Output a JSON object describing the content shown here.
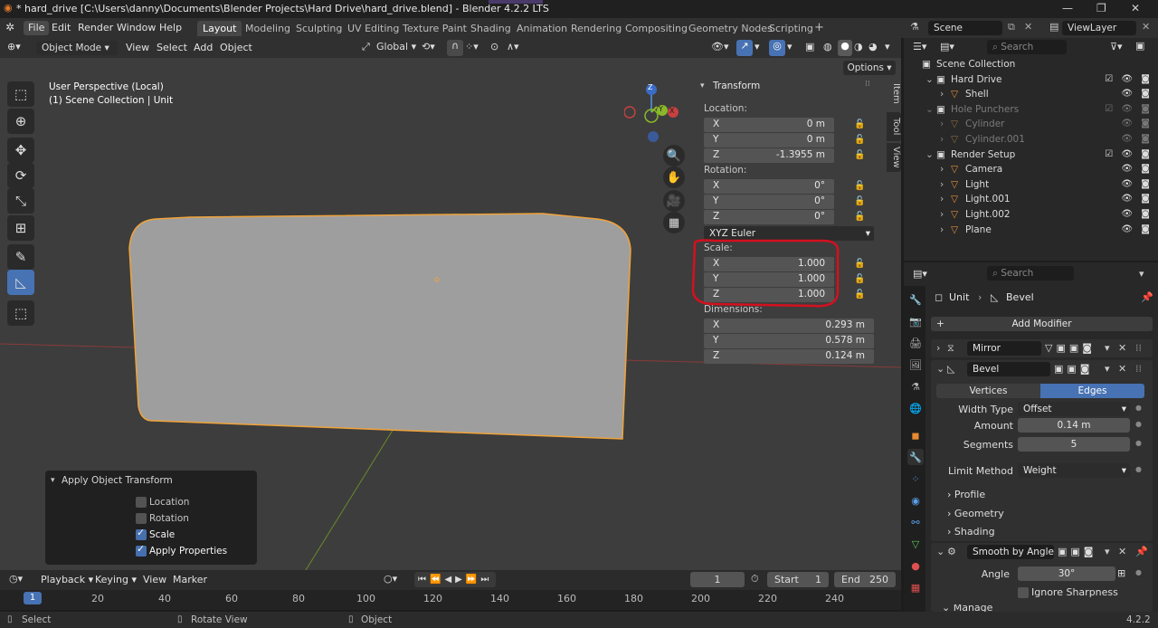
{
  "titlebar": {
    "title": "* hard_drive [C:\\Users\\danny\\Documents\\Blender Projects\\Hard Drive\\hard_drive.blend] - Blender 4.2.2 LTS"
  },
  "menus": [
    "File",
    "Edit",
    "Render",
    "Window",
    "Help"
  ],
  "workspaces": [
    "Layout",
    "Modeling",
    "Sculpting",
    "UV Editing",
    "Texture Paint",
    "Shading",
    "Animation",
    "Rendering",
    "Compositing",
    "Geometry Nodes",
    "Scripting"
  ],
  "active_workspace": "Layout",
  "scene": {
    "label": "Scene",
    "viewlayer": "ViewLayer"
  },
  "vp_header": {
    "mode": "Object Mode",
    "view": "View",
    "select": "Select",
    "add": "Add",
    "object": "Object",
    "orientation": "Global",
    "options": "Options"
  },
  "viewport": {
    "perspective": "User Perspective (Local)",
    "collection": "(1) Scene Collection | Unit"
  },
  "gizmo": {
    "z": "Z",
    "y": "Y",
    "x": "X"
  },
  "npanel": {
    "tabs": [
      "Item",
      "Tool",
      "View"
    ],
    "header": "Transform",
    "location_label": "Location:",
    "location": [
      {
        "axis": "X",
        "value": "0 m"
      },
      {
        "axis": "Y",
        "value": "0 m"
      },
      {
        "axis": "Z",
        "value": "-1.3955 m"
      }
    ],
    "rotation_label": "Rotation:",
    "rotation": [
      {
        "axis": "X",
        "value": "0°"
      },
      {
        "axis": "Y",
        "value": "0°"
      },
      {
        "axis": "Z",
        "value": "0°"
      }
    ],
    "rotation_mode": "XYZ Euler",
    "scale_label": "Scale:",
    "scale": [
      {
        "axis": "X",
        "value": "1.000"
      },
      {
        "axis": "Y",
        "value": "1.000"
      },
      {
        "axis": "Z",
        "value": "1.000"
      }
    ],
    "dimensions_label": "Dimensions:",
    "dimensions": [
      {
        "axis": "X",
        "value": "0.293 m"
      },
      {
        "axis": "Y",
        "value": "0.578 m"
      },
      {
        "axis": "Z",
        "value": "0.124 m"
      }
    ],
    "highlight_color": "#d4101f"
  },
  "apply_panel": {
    "title": "Apply Object Transform",
    "items": [
      {
        "label": "Location",
        "checked": false
      },
      {
        "label": "Rotation",
        "checked": false
      },
      {
        "label": "Scale",
        "checked": true
      },
      {
        "label": "Apply Properties",
        "checked": true
      }
    ]
  },
  "timeline": {
    "playback": "Playback",
    "keying": "Keying",
    "view": "View",
    "marker": "Marker",
    "current_frame": "1",
    "start_label": "Start",
    "start": "1",
    "end_label": "End",
    "end": "250",
    "ruler": [
      "1",
      "20",
      "40",
      "60",
      "80",
      "100",
      "120",
      "140",
      "160",
      "180",
      "200",
      "220",
      "240"
    ]
  },
  "statusbar": {
    "select": "Select",
    "rotate": "Rotate View",
    "object": "Object",
    "version": "4.2.2"
  },
  "outliner": {
    "search_placeholder": "Search",
    "rows": [
      {
        "name": "Scene Collection",
        "indent": 0,
        "dim": false
      },
      {
        "name": "Hard Drive",
        "indent": 1,
        "dim": false
      },
      {
        "name": "Shell",
        "indent": 2,
        "dim": false
      },
      {
        "name": "Hole Punchers",
        "indent": 1,
        "dim": true
      },
      {
        "name": "Cylinder",
        "indent": 2,
        "dim": true
      },
      {
        "name": "Cylinder.001",
        "indent": 2,
        "dim": true
      },
      {
        "name": "Render Setup",
        "indent": 1,
        "dim": false
      },
      {
        "name": "Camera",
        "indent": 2,
        "dim": false
      },
      {
        "name": "Light",
        "indent": 2,
        "dim": false
      },
      {
        "name": "Light.001",
        "indent": 2,
        "dim": false
      },
      {
        "name": "Light.002",
        "indent": 2,
        "dim": false
      },
      {
        "name": "Plane",
        "indent": 2,
        "dim": false
      }
    ]
  },
  "properties": {
    "search_placeholder": "Search",
    "object": "Unit",
    "modifier_crumb": "Bevel",
    "add_modifier": "Add Modifier",
    "mirror": "Mirror",
    "bevel": {
      "name": "Bevel",
      "vertices": "Vertices",
      "edges": "Edges",
      "width_type_label": "Width Type",
      "width_type": "Offset",
      "amount_label": "Amount",
      "amount": "0.14 m",
      "segments_label": "Segments",
      "segments": "5",
      "limit_label": "Limit Method",
      "limit": "Weight",
      "profile": "Profile",
      "geometry": "Geometry",
      "shading": "Shading"
    },
    "smooth": {
      "name": "Smooth by Angle",
      "angle_label": "Angle",
      "angle": "30°",
      "ignore": "Ignore Sharpness",
      "manage": "Manage"
    }
  }
}
